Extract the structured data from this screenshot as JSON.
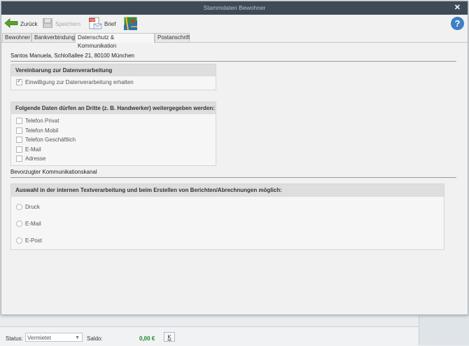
{
  "dialog": {
    "title": "Stammdaten Bewohner",
    "close_glyph": "✕"
  },
  "toolbar": {
    "back_label": "Zurück",
    "save_label": "Speichern",
    "letter_label": "Brief",
    "help_glyph": "?"
  },
  "tabs": [
    {
      "label": "Bewohner"
    },
    {
      "label": "Bankverbindung"
    },
    {
      "label": "Datenschutz & Kommunikation",
      "active": true
    },
    {
      "label": "Postanschrift"
    }
  ],
  "resident_line": "Santos Manuela, Schloßallee 21, 80100 München",
  "consent": {
    "header": "Vereinbarung zur Datenverarbeitung",
    "checkbox_label": "Einwilligung zur Datenverarbeitung erhalten",
    "checked": true
  },
  "share": {
    "header": "Folgende Daten dürfen an Dritte (z. B. Handwerker) weitergegeben werden:",
    "items": [
      {
        "label": "Telefon Privat",
        "checked": false
      },
      {
        "label": "Telefon Mobil",
        "checked": false
      },
      {
        "label": "Telefon Geschäftlich",
        "checked": false
      },
      {
        "label": "E-Mail",
        "checked": false
      },
      {
        "label": "Adresse",
        "checked": false
      }
    ]
  },
  "channel": {
    "section_title": "Bevorzugter Kommunikationskanal",
    "header": "Auswahl in der internen Textverarbeitung und beim Erstellen von Berichten/Abrechnungen  möglich:",
    "options": [
      {
        "label": "Druck"
      },
      {
        "label": "E-Mail"
      },
      {
        "label": "E-Post"
      }
    ]
  },
  "statusbar": {
    "status_label": "Status:",
    "status_value": "Vermietet",
    "saldo_label": "Saldo:",
    "saldo_value": "0,00 €",
    "k_label": "K"
  },
  "colors": {
    "titlebar": "#3e4a55",
    "help": "#3f7fc4",
    "saldo": "#1a8a22",
    "back_arrow": "#5aa02c"
  },
  "icons": [
    "back-arrow-icon",
    "save-disk-icon",
    "letter-pdf-icon",
    "map-icon",
    "help-icon",
    "close-icon",
    "checkmark-icon",
    "dropdown-arrow-icon"
  ]
}
